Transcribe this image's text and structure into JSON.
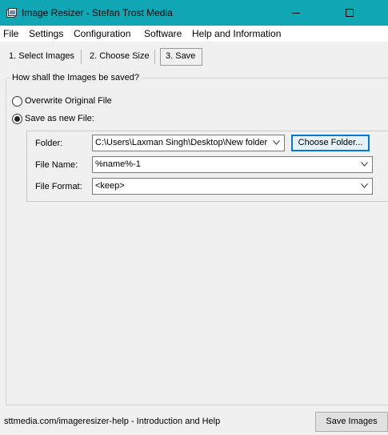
{
  "window": {
    "title": "Image Resizer - Stefan Trost Media",
    "icons": {
      "app": "app-icon",
      "minimize": "minimize-icon",
      "maximize": "maximize-icon"
    }
  },
  "menu": {
    "items": [
      "File",
      "Settings",
      "Configuration",
      "Software",
      "Help and Information"
    ]
  },
  "tabs": {
    "items": [
      "1. Select Images",
      "2. Choose Size",
      "3. Save"
    ],
    "active_index": 2
  },
  "group": {
    "title": "How shall the Images be saved?",
    "options": [
      {
        "label": "Overwrite Original File",
        "checked": false
      },
      {
        "label": "Save as new File:",
        "checked": true
      }
    ]
  },
  "fields": {
    "folder": {
      "label": "Folder:",
      "value": "C:\\Users\\Laxman Singh\\Desktop\\New folder",
      "button": "Choose Folder..."
    },
    "file_name": {
      "label": "File Name:",
      "value": "%name%-1"
    },
    "file_format": {
      "label": "File Format:",
      "value": "<keep>"
    }
  },
  "footer": {
    "link": "sttmedia.com/imageresizer-help - Introduction and Help",
    "save_button": "Save Images"
  }
}
